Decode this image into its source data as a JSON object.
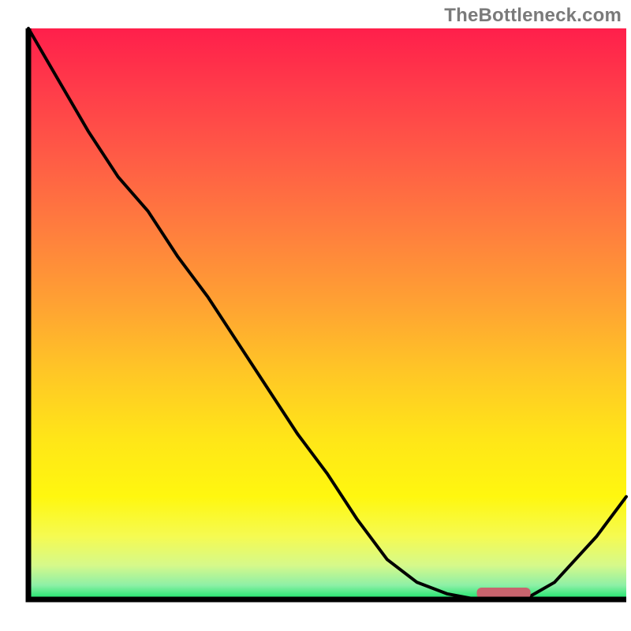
{
  "attribution": "TheBottleneck.com",
  "chart_data": {
    "type": "line",
    "title": "",
    "xlabel": "",
    "ylabel": "",
    "categories": [
      0,
      5,
      10,
      15,
      20,
      25,
      30,
      35,
      40,
      45,
      50,
      55,
      60,
      65,
      70,
      75,
      80,
      83,
      88,
      95,
      100
    ],
    "values": [
      100,
      91,
      82,
      74,
      68,
      60,
      53,
      45,
      37,
      29,
      22,
      14,
      7,
      3,
      1,
      0,
      0,
      0,
      3,
      11,
      18
    ],
    "xlim": [
      0,
      100
    ],
    "ylim": [
      0,
      100
    ],
    "marker": {
      "x_start": 75,
      "x_end": 84,
      "color": "#c8646e"
    },
    "gradient_stops": [
      {
        "offset": 0.0,
        "color": "#ff1f4b"
      },
      {
        "offset": 0.1,
        "color": "#ff3a4a"
      },
      {
        "offset": 0.22,
        "color": "#ff5a46"
      },
      {
        "offset": 0.35,
        "color": "#ff7d3e"
      },
      {
        "offset": 0.48,
        "color": "#ffa133"
      },
      {
        "offset": 0.6,
        "color": "#ffc626"
      },
      {
        "offset": 0.72,
        "color": "#ffe618"
      },
      {
        "offset": 0.82,
        "color": "#fff70f"
      },
      {
        "offset": 0.89,
        "color": "#f5fb52"
      },
      {
        "offset": 0.94,
        "color": "#d6f98a"
      },
      {
        "offset": 0.975,
        "color": "#8ef0a6"
      },
      {
        "offset": 1.0,
        "color": "#17e36a"
      }
    ],
    "axes": {
      "stroke": "#000000",
      "stroke_width": 7
    },
    "curve": {
      "stroke": "#000000",
      "stroke_width": 4
    }
  }
}
